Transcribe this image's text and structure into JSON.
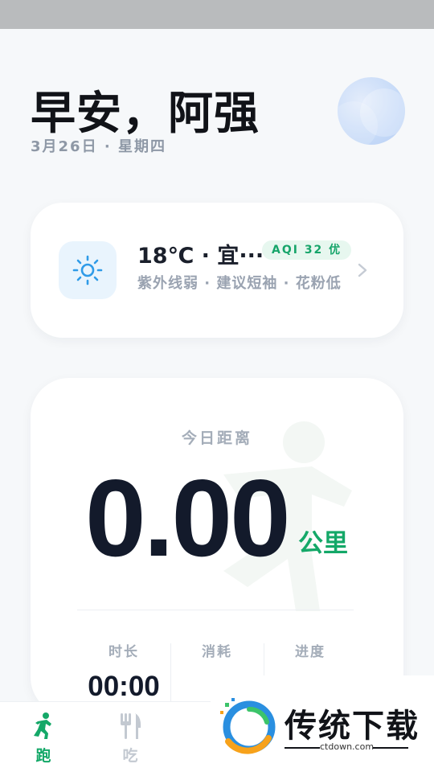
{
  "header": {
    "greeting": "早安，阿强",
    "date": "3月26日 · 星期四"
  },
  "weather": {
    "temp_summary": "18℃ · 宜···",
    "aqi_badge": "AQI 32 优",
    "description": "紫外线弱 · 建议短袖 · 花粉低",
    "icon": "sun-icon"
  },
  "today": {
    "label": "今日距离",
    "distance": "0.00",
    "unit": "公里"
  },
  "stats": [
    {
      "label": "时长",
      "value": "00:00"
    },
    {
      "label": "消耗",
      "value": ""
    },
    {
      "label": "进度",
      "value": ""
    }
  ],
  "tabbar": {
    "tabs": [
      {
        "label": "跑",
        "icon": "run-icon"
      },
      {
        "label": "吃",
        "icon": "fork-knife-icon"
      }
    ]
  },
  "watermark": {
    "brand": "传统下载",
    "url": "ctdown.com"
  },
  "colors": {
    "accent": "#14a868",
    "aqi_bg": "#e7f7ef",
    "inactive": "#c3c9d1"
  }
}
